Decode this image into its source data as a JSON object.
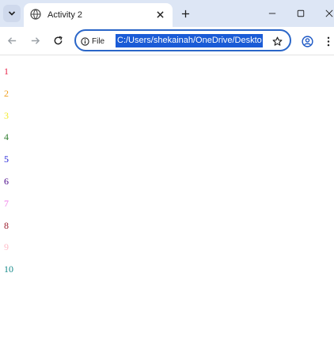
{
  "browser": {
    "tab": {
      "title": "Activity 2"
    },
    "omnibox": {
      "site_info_label": "File",
      "url": "C:/Users/shekainah/OneDrive/Deskto"
    },
    "icons": {
      "tab_search": "chevron-down-icon",
      "favicon": "globe-icon",
      "tab_close": "close-icon",
      "new_tab": "plus-icon",
      "minimize": "minimize-icon",
      "maximize": "maximize-icon",
      "window_close": "close-icon",
      "back": "arrow-left-icon",
      "forward": "arrow-right-icon",
      "reload": "reload-icon",
      "info": "info-icon",
      "bookmark": "star-icon",
      "profile": "profile-icon",
      "menu": "kebab-menu-icon"
    },
    "colors": {
      "tabstrip_bg": "#dde6f5",
      "omnibox_border": "#2a66c8",
      "selection_bg": "#1a5bd6"
    }
  },
  "page": {
    "items": [
      {
        "text": "1",
        "color": "#e8264b"
      },
      {
        "text": "2",
        "color": "#f0a020"
      },
      {
        "text": "3",
        "color": "#f2ea2a"
      },
      {
        "text": "4",
        "color": "#2f7d2f"
      },
      {
        "text": "5",
        "color": "#1a1ad6"
      },
      {
        "text": "6",
        "color": "#4b0a8a"
      },
      {
        "text": "7",
        "color": "#f07ae8"
      },
      {
        "text": "8",
        "color": "#9a1a2a"
      },
      {
        "text": "9",
        "color": "#ffbcc8"
      },
      {
        "text": "10",
        "color": "#178a8a"
      }
    ]
  }
}
